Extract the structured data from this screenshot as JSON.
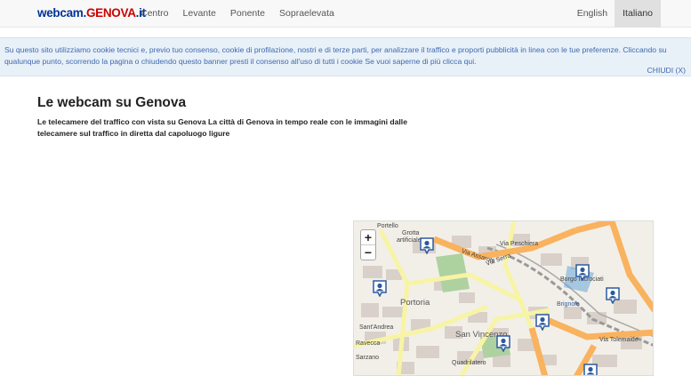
{
  "navbar": {
    "brand_part1": "webcam.",
    "brand_part2": "GENOVA",
    "brand_part3": ".it",
    "left_items": [
      "Centro",
      "Levante",
      "Ponente",
      "Sopraelevata"
    ],
    "right_items": [
      "English",
      "Italiano"
    ],
    "active_language": "Italiano"
  },
  "cookie_banner": {
    "text": "Su questo sito utilizziamo cookie tecnici e, previo tuo consenso, cookie di profilazione, nostri e di terze parti, per analizzare il traffico e proporti pubblicità in linea con le tue preferenze. Cliccando su qualunque punto, scorrendo la pagina o chiudendo questo banner presti il consenso all'uso di tutti i cookie Se vuoi saperne di più clicca qui.",
    "close_label": "CHIUDI (X)"
  },
  "main": {
    "title": "Le webcam su Genova",
    "description": "Le telecamere del traffico con vista su Genova La città di Genova in tempo reale con le immagini dalle telecamere sul traffico in diretta dal capoluogo ligure"
  },
  "map": {
    "zoom_in": "+",
    "zoom_out": "−",
    "labels": {
      "portello": "Portello",
      "grotta": "Grotta",
      "artificiale": "artificiale",
      "via_assarotti": "Via Assarotti",
      "via_peschiera": "Via Peschiera",
      "via_serra": "Via Serra",
      "portoria": "Portoria",
      "borgo_incrociati": "Borgo Incrociati",
      "brignole": "Brignole",
      "san_vincenzo": "San Vincenzo",
      "sant_andrea": "Sant'Andrea",
      "ravecca": "Ravecca",
      "quadrilatero": "Quadrilatero",
      "sarzano": "Sarzano",
      "via_tolemaide": "Via Tolemaide"
    },
    "colors": {
      "land": "#f2efe9",
      "major_road": "#f9b25e",
      "secondary_road": "#f7f4a6",
      "park": "#aed1a0",
      "building": "#d9d0c9",
      "marker": "#2c5aa0"
    }
  }
}
